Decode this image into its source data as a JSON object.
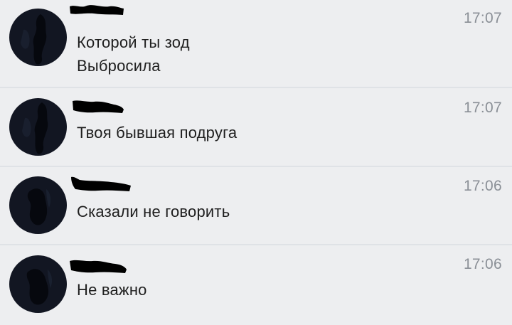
{
  "dialogs": [
    {
      "time": "17:07",
      "lines": [
        "Которой ты зод",
        "Выбросила"
      ],
      "avatar_icon": "user-avatar-icon",
      "name_redacted": true
    },
    {
      "time": "17:07",
      "lines": [
        "Твоя бывшая подруга"
      ],
      "avatar_icon": "user-avatar-icon",
      "name_redacted": true
    },
    {
      "time": "17:06",
      "lines": [
        "Сказали не говорить"
      ],
      "avatar_icon": "user-avatar-icon",
      "name_redacted": true
    },
    {
      "time": "17:06",
      "lines": [
        "Не важно"
      ],
      "avatar_icon": "user-avatar-icon",
      "name_redacted": true
    }
  ],
  "colors": {
    "background": "#edeef0",
    "divider": "#dfe2e6",
    "time_text": "#8a8f96",
    "message_text": "#1e1e1e",
    "avatar_fill": "#121622",
    "redaction": "#000000"
  }
}
